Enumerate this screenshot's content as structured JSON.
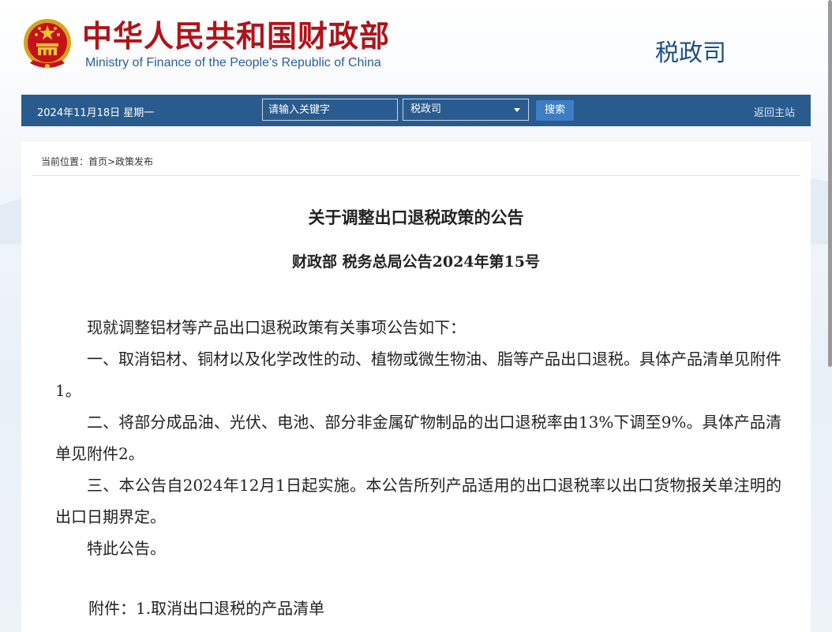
{
  "header": {
    "cn_title": "中华人民共和国财政部",
    "en_title": "Ministry of Finance of the People's Republic of China",
    "department": "税政司",
    "emblem_icon": "national-emblem-icon"
  },
  "nav": {
    "date": "2024年11月18日  星期一",
    "search_placeholder": "请输入关键字",
    "select_value": "税政司",
    "search_button": "搜索",
    "home_link": "返回主站"
  },
  "breadcrumb": "当前位置：首页>政策发布",
  "article": {
    "title": "关于调整出口退税政策的公告",
    "doc_no": "财政部 税务总局公告2024年第15号",
    "paragraphs": [
      "现就调整铝材等产品出口退税政策有关事项公告如下：",
      "一、取消铝材、铜材以及化学改性的动、植物或微生物油、脂等产品出口退税。具体产品清单见附件1。",
      "二、将部分成品油、光伏、电池、部分非金属矿物制品的出口退税率由13%下调至9%。具体产品清单见附件2。",
      "三、本公告自2024年12月1日起实施。本公告所列产品适用的出口退税率以出口货物报关单注明的出口日期界定。",
      "特此公告。"
    ],
    "attachment": "附件：1.取消出口退税的产品清单"
  },
  "colors": {
    "brand_red": "#b01319",
    "nav_blue": "#2a5b8e",
    "title_blue": "#2e5d9a"
  }
}
